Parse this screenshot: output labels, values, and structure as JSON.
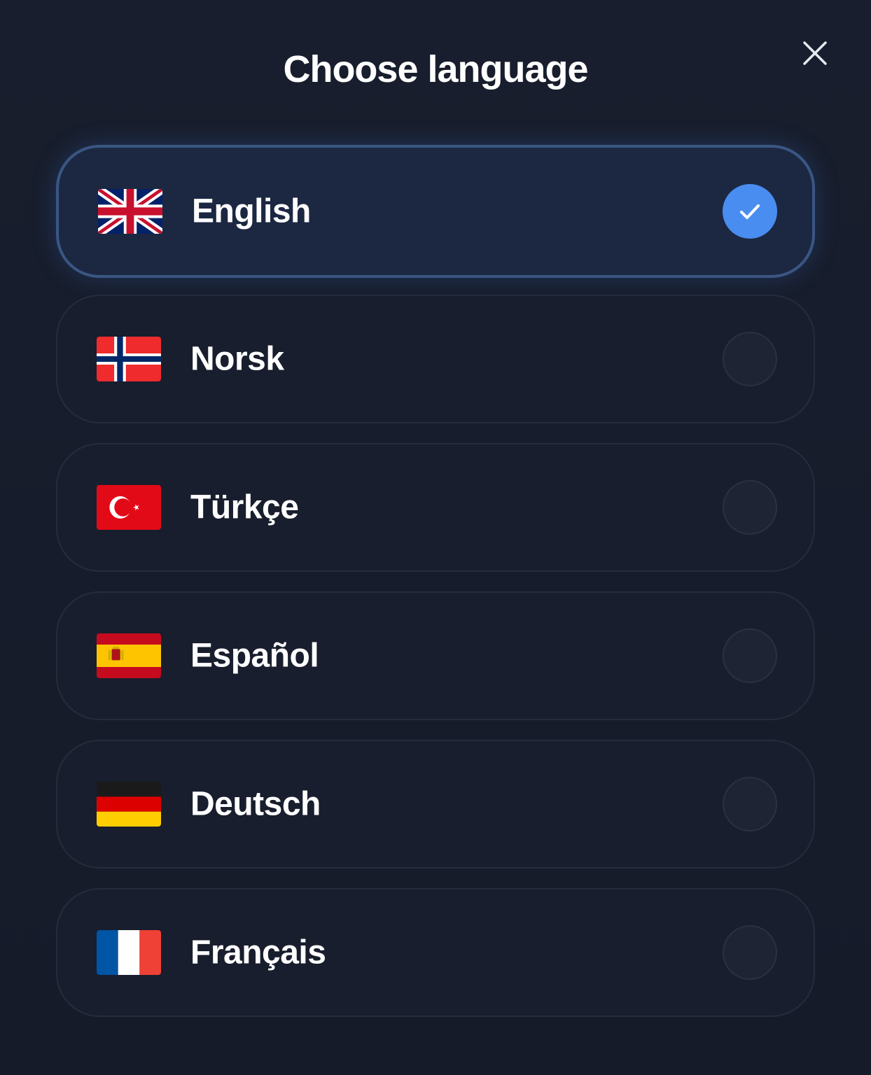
{
  "modal": {
    "title": "Choose language"
  },
  "languages": [
    {
      "label": "English",
      "flag": "uk-flag-icon",
      "selected": true
    },
    {
      "label": "Norsk",
      "flag": "norway-flag-icon",
      "selected": false
    },
    {
      "label": "Türkçe",
      "flag": "turkey-flag-icon",
      "selected": false
    },
    {
      "label": "Español",
      "flag": "spain-flag-icon",
      "selected": false
    },
    {
      "label": "Deutsch",
      "flag": "germany-flag-icon",
      "selected": false
    },
    {
      "label": "Français",
      "flag": "france-flag-icon",
      "selected": false
    }
  ],
  "icons": {
    "close": "close-icon",
    "check": "checkmark-icon"
  },
  "colors": {
    "background": "#161c2b",
    "selected_border": "#3a5683",
    "selected_fill": "#1c2842",
    "accent": "#4a8df0"
  }
}
